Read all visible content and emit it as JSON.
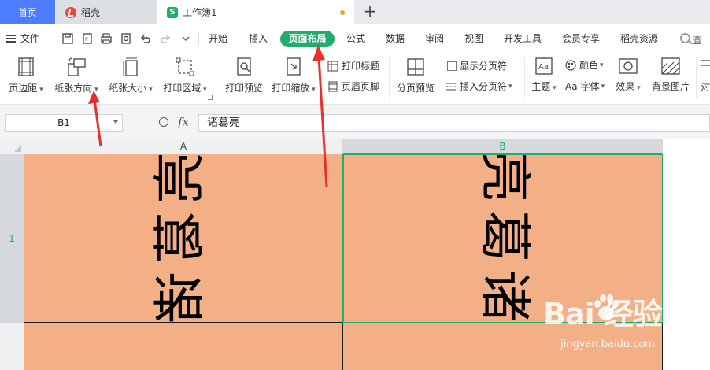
{
  "tabs": {
    "home": "首页",
    "daoke": "稻壳",
    "workbook": "工作簿1",
    "add": "+"
  },
  "menubar": {
    "file": "文件",
    "items": [
      "开始",
      "插入",
      "页面布局",
      "公式",
      "数据",
      "审阅",
      "视图",
      "开发工具",
      "会员专享",
      "稻壳资源"
    ],
    "active": "页面布局",
    "search_label": "查"
  },
  "ribbon": {
    "margins": "页边距",
    "orientation": "纸张方向",
    "size": "纸张大小",
    "print_area": "打印区域",
    "print_preview": "打印预览",
    "print_scale": "打印缩放",
    "print_titles": "打印标题",
    "header_footer": "页眉页脚",
    "page_break_preview": "分页预览",
    "show_page_breaks": "显示分页符",
    "insert_page_break": "插入分页符",
    "theme": "主题",
    "colors": "颜色",
    "fonts": "字体",
    "effects": "效果",
    "background": "背景图片",
    "cutoff": "对"
  },
  "formula_bar": {
    "cell_ref": "B1",
    "fx": "fx",
    "value": "诸葛亮"
  },
  "grid": {
    "columns": [
      "A",
      "B"
    ],
    "rows": [
      "1"
    ],
    "selected_column": "B",
    "cell_A1_chars": [
      "诸",
      "葛",
      "亮"
    ],
    "cell_B1_chars": [
      "诸",
      "葛",
      "亮"
    ]
  },
  "colors": {
    "accent_green": "#1fae6b",
    "cell_fill": "#f3b086",
    "home_tab": "#4d7cfe",
    "annotation_red": "#e8302a"
  },
  "watermark": {
    "logo": "Bai  经验",
    "url": "jingyan.baidu.com"
  }
}
